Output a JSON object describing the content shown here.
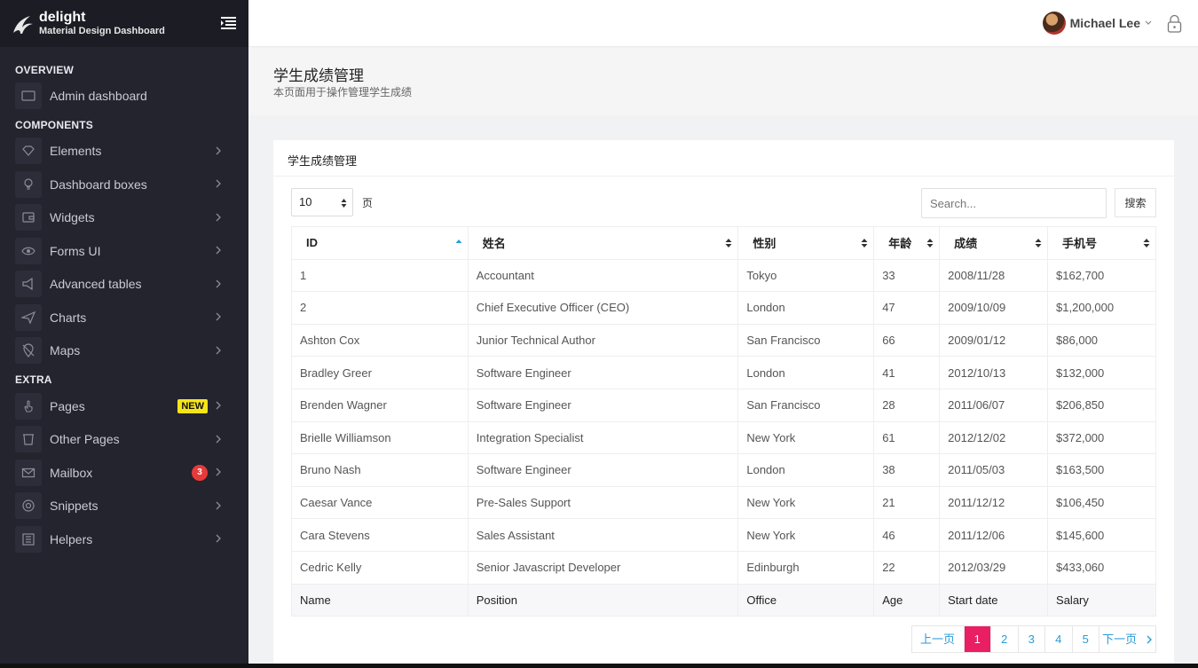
{
  "brand": {
    "title": "delight",
    "subtitle": "Material Design Dashboard"
  },
  "sidebar": {
    "sections": {
      "overview": "OVERVIEW",
      "components": "COMPONENTS",
      "extra": "EXTRA"
    },
    "items": {
      "admin_dashboard": "Admin dashboard",
      "elements": "Elements",
      "dashboard_boxes": "Dashboard boxes",
      "widgets": "Widgets",
      "forms_ui": "Forms UI",
      "advanced_tables": "Advanced tables",
      "charts": "Charts",
      "maps": "Maps",
      "pages": "Pages",
      "other_pages": "Other Pages",
      "mailbox": "Mailbox",
      "snippets": "Snippets",
      "helpers": "Helpers"
    },
    "badges": {
      "pages": "NEW",
      "mailbox": "3"
    }
  },
  "topbar": {
    "user_name": "Michael Lee"
  },
  "page": {
    "title": "学生成绩管理",
    "subtitle": "本页面用于操作管理学生成绩"
  },
  "card": {
    "title": "学生成绩管理",
    "page_length": "10",
    "page_length_suffix": "页",
    "search_placeholder": "Search...",
    "search_button": "搜索"
  },
  "table": {
    "headers": [
      "ID",
      "姓名",
      "性别",
      "年龄",
      "成绩",
      "手机号"
    ],
    "rows": [
      [
        "1",
        "Accountant",
        "Tokyo",
        "33",
        "2008/11/28",
        "$162,700"
      ],
      [
        "2",
        "Chief Executive Officer (CEO)",
        "London",
        "47",
        "2009/10/09",
        "$1,200,000"
      ],
      [
        "Ashton Cox",
        "Junior Technical Author",
        "San Francisco",
        "66",
        "2009/01/12",
        "$86,000"
      ],
      [
        "Bradley Greer",
        "Software Engineer",
        "London",
        "41",
        "2012/10/13",
        "$132,000"
      ],
      [
        "Brenden Wagner",
        "Software Engineer",
        "San Francisco",
        "28",
        "2011/06/07",
        "$206,850"
      ],
      [
        "Brielle Williamson",
        "Integration Specialist",
        "New York",
        "61",
        "2012/12/02",
        "$372,000"
      ],
      [
        "Bruno Nash",
        "Software Engineer",
        "London",
        "38",
        "2011/05/03",
        "$163,500"
      ],
      [
        "Caesar Vance",
        "Pre-Sales Support",
        "New York",
        "21",
        "2011/12/12",
        "$106,450"
      ],
      [
        "Cara Stevens",
        "Sales Assistant",
        "New York",
        "46",
        "2011/12/06",
        "$145,600"
      ],
      [
        "Cedric Kelly",
        "Senior Javascript Developer",
        "Edinburgh",
        "22",
        "2012/03/29",
        "$433,060"
      ]
    ],
    "footer": [
      "Name",
      "Position",
      "Office",
      "Age",
      "Start date",
      "Salary"
    ]
  },
  "pagination": {
    "prev": "上一页",
    "pages": [
      "1",
      "2",
      "3",
      "4",
      "5"
    ],
    "next": "下一页",
    "active": "1"
  },
  "colors": {
    "accent": "#e91e63",
    "sidebar": "#23242e",
    "link": "#2a9bd6",
    "badge_new": "#f5e419",
    "badge_count": "#e93a3a"
  }
}
